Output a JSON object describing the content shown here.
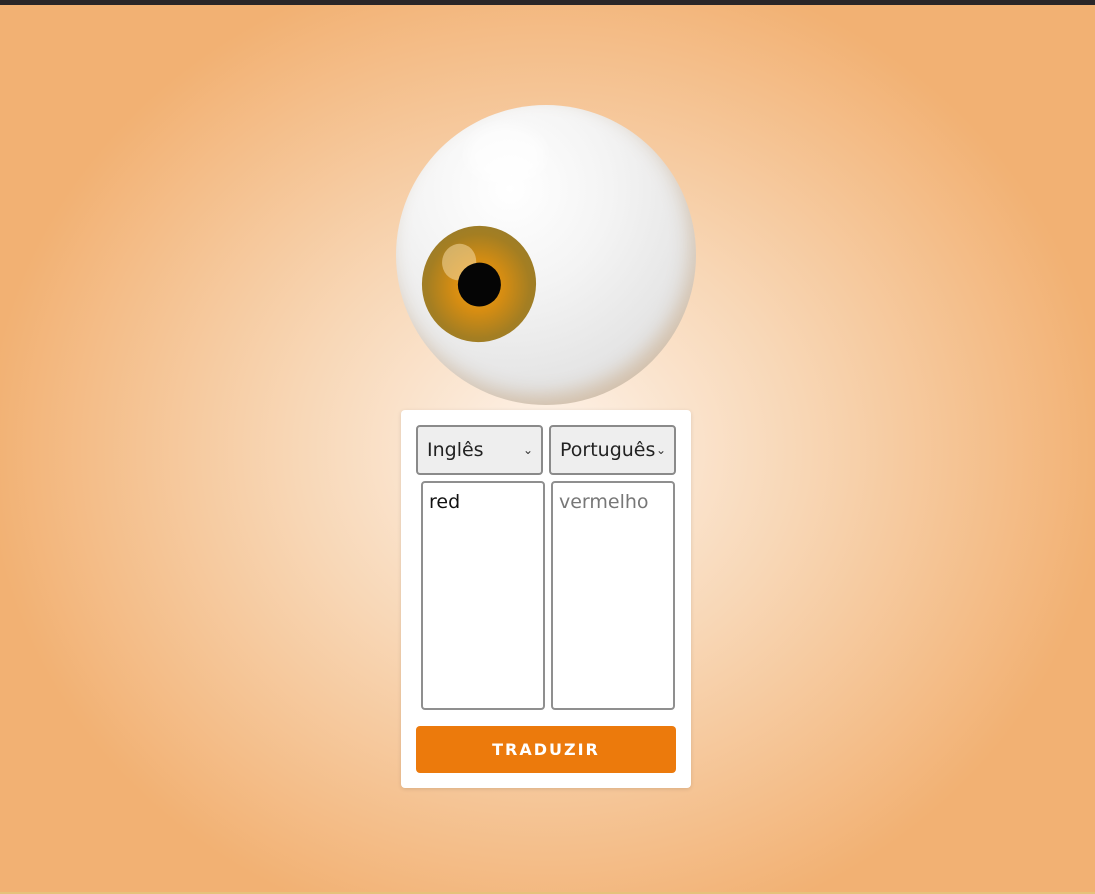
{
  "translator": {
    "source_language": "Inglês",
    "target_language": "Português",
    "input_text": "red",
    "output_placeholder": "vermelho",
    "button_label": "TRADUZIR"
  },
  "colors": {
    "button": "#ec7a0c",
    "background_edge": "#f2b173",
    "background_center": "#fdf3ea"
  },
  "icons": {
    "select_chevron": "chevron-down-icon",
    "mascot": "eyeball-icon"
  }
}
